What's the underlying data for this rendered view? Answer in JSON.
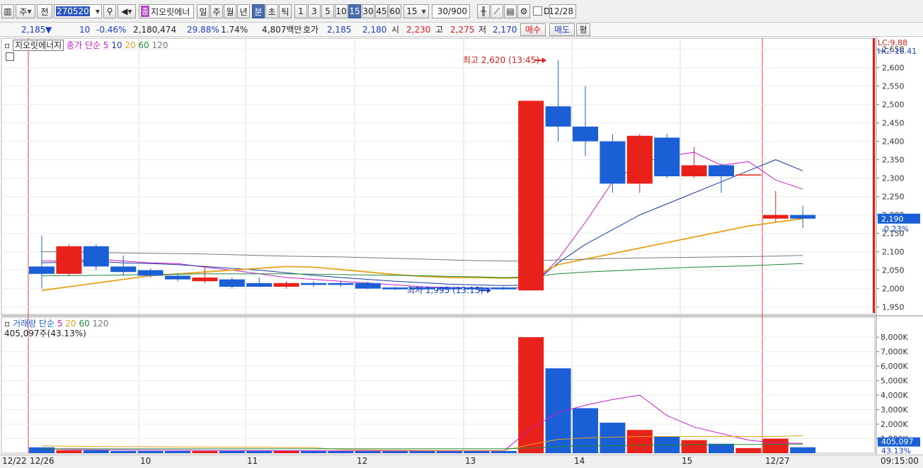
{
  "toolbar": {
    "market_buttons": [
      "주",
      "전"
    ],
    "stock_code": "270520",
    "stock_name_badge": "종",
    "stock_name": "지오릿에너",
    "period_buttons": [
      "일",
      "주",
      "월",
      "년",
      "분",
      "초",
      "틱"
    ],
    "selected_period": "분",
    "interval_buttons": [
      "1",
      "3",
      "5",
      "10",
      "15",
      "30",
      "45",
      "60"
    ],
    "selected_interval": "15",
    "interval_value": "15",
    "count_value": "30/900",
    "date_checkbox_label": "D",
    "date_value": "12/28"
  },
  "quote": {
    "price": "2,185",
    "change_arrow": "▼",
    "change": "10",
    "change_pct": "-0.46%",
    "volume": "2,180,474",
    "turnover_pct": "29.88%",
    "ratio": "1.74%",
    "amount": "4,807백만",
    "bid_label": "호가",
    "ask": "2,185",
    "bid": "2,180",
    "open_label": "시",
    "open": "2,230",
    "high_label": "고",
    "high": "2,275",
    "low_label": "저",
    "low": "2,170",
    "buy_button": "매수",
    "sell_button": "매도",
    "eval_button": "평"
  },
  "price_legend": {
    "stock_name": "지오릿에너지",
    "indicator": "종가 단순",
    "periods": [
      "5",
      "10",
      "20",
      "60",
      "120"
    ],
    "period_colors": [
      "#c81ec8",
      "#1a3a9e",
      "#e6a21a",
      "#1e8a3a",
      "#7a7a7a"
    ]
  },
  "volume_legend": {
    "indicator": "거래량 단순",
    "periods": [
      "5",
      "20",
      "60",
      "120"
    ],
    "current": "405,097주(43.13%)"
  },
  "annotations": {
    "high_label": "최고 2,620 (13:45)",
    "low_label": "최저 1,995 (13:15)",
    "lc": "LC:9.88",
    "hc": "HC:-16.41",
    "price_tag": "2,190",
    "price_tag_pct": "-0.23%",
    "volume_tag": "405,097",
    "volume_tag_pct": "43.13%"
  },
  "x_axis_labels": [
    "12/22",
    "12/26",
    "10",
    "11",
    "12",
    "13",
    "14",
    "15",
    "12/27"
  ],
  "time_label": "09:15:00",
  "colors": {
    "up": "#e8221a",
    "down": "#1a5fd6",
    "accent": "#4a6fb0"
  },
  "chart_data": [
    {
      "type": "candlestick",
      "title": "",
      "ylabel": "",
      "ylim": [
        1930,
        2680
      ],
      "y_ticks": [
        1950,
        2000,
        2050,
        2100,
        2150,
        2200,
        2250,
        2300,
        2350,
        2400,
        2450,
        2500,
        2550,
        2600,
        2650
      ],
      "candles": [
        {
          "o": 2060,
          "c": 2040,
          "h": 2145,
          "l": 2000
        },
        {
          "o": 2040,
          "c": 2115,
          "h": 2120,
          "l": 2035
        },
        {
          "o": 2115,
          "c": 2060,
          "h": 2120,
          "l": 2050
        },
        {
          "o": 2060,
          "c": 2045,
          "h": 2090,
          "l": 2035
        },
        {
          "o": 2050,
          "c": 2035,
          "h": 2055,
          "l": 2030
        },
        {
          "o": 2035,
          "c": 2025,
          "h": 2040,
          "l": 2020
        },
        {
          "o": 2020,
          "c": 2030,
          "h": 2060,
          "l": 2015
        },
        {
          "o": 2025,
          "c": 2005,
          "h": 2030,
          "l": 2000
        },
        {
          "o": 2015,
          "c": 2005,
          "h": 2030,
          "l": 2005
        },
        {
          "o": 2005,
          "c": 2015,
          "h": 2020,
          "l": 2000
        },
        {
          "o": 2015,
          "c": 2010,
          "h": 2020,
          "l": 2005
        },
        {
          "o": 2015,
          "c": 2010,
          "h": 2020,
          "l": 2005
        },
        {
          "o": 2015,
          "c": 2000,
          "h": 2020,
          "l": 1998
        },
        {
          "o": 2003,
          "c": 1998,
          "h": 2005,
          "l": 1996
        },
        {
          "o": 2003,
          "c": 1998,
          "h": 2005,
          "l": 1996
        },
        {
          "o": 2003,
          "c": 1998,
          "h": 2005,
          "l": 1996
        },
        {
          "o": 2003,
          "c": 1998,
          "h": 2005,
          "l": 1996
        },
        {
          "o": 2003,
          "c": 1998,
          "h": 2005,
          "l": 1996
        },
        {
          "o": 1995,
          "c": 2510,
          "h": 2510,
          "l": 1995
        },
        {
          "o": 2495,
          "c": 2440,
          "h": 2620,
          "l": 2400
        },
        {
          "o": 2440,
          "c": 2400,
          "h": 2550,
          "l": 2360
        },
        {
          "o": 2400,
          "c": 2285,
          "h": 2420,
          "l": 2260
        },
        {
          "o": 2285,
          "c": 2415,
          "h": 2420,
          "l": 2260
        },
        {
          "o": 2410,
          "c": 2305,
          "h": 2420,
          "l": 2300
        },
        {
          "o": 2305,
          "c": 2335,
          "h": 2385,
          "l": 2300
        },
        {
          "o": 2335,
          "c": 2305,
          "h": 2340,
          "l": 2260
        },
        {
          "o": 2310,
          "c": 2310,
          "h": 2310,
          "l": 2310
        },
        {
          "o": 2190,
          "c": 2200,
          "h": 2265,
          "l": 2180
        },
        {
          "o": 2200,
          "c": 2190,
          "h": 2225,
          "l": 2165
        }
      ],
      "ma": [
        {
          "name": "5",
          "values": [
            2075,
            2075,
            2080,
            2075,
            2070,
            2068,
            2058,
            2050,
            2040,
            2030,
            2025,
            2020,
            2015,
            2010,
            2005,
            2003,
            2002,
            2000,
            2005,
            2080,
            2180,
            2290,
            2340,
            2360,
            2370,
            2335,
            2345,
            2295,
            2270
          ]
        },
        {
          "name": "10",
          "values": [
            2070,
            2072,
            2074,
            2070,
            2068,
            2065,
            2060,
            2055,
            2050,
            2043,
            2036,
            2030,
            2025,
            2020,
            2016,
            2012,
            2010,
            2008,
            2010,
            2070,
            2120,
            2160,
            2200,
            2230,
            2260,
            2290,
            2320,
            2350,
            2320
          ]
        },
        {
          "name": "20",
          "values": [
            1995,
            2005,
            2015,
            2025,
            2035,
            2040,
            2045,
            2050,
            2055,
            2060,
            2058,
            2052,
            2045,
            2038,
            2033,
            2030,
            2030,
            2028,
            2030,
            2065,
            2080,
            2095,
            2110,
            2125,
            2140,
            2155,
            2170,
            2180,
            2190
          ]
        },
        {
          "name": "60",
          "values": [
            2035,
            2035,
            2036,
            2037,
            2038,
            2039,
            2040,
            2040,
            2040,
            2040,
            2039,
            2038,
            2037,
            2036,
            2035,
            2033,
            2032,
            2030,
            2032,
            2040,
            2045,
            2048,
            2052,
            2055,
            2058,
            2060,
            2062,
            2065,
            2068
          ]
        },
        {
          "name": "120",
          "values": [
            2100,
            2100,
            2098,
            2097,
            2096,
            2095,
            2094,
            2092,
            2090,
            2088,
            2087,
            2086,
            2084,
            2082,
            2080,
            2078,
            2076,
            2075,
            2075,
            2078,
            2080,
            2082,
            2083,
            2084,
            2085,
            2086,
            2087,
            2088,
            2090
          ]
        }
      ]
    },
    {
      "type": "bar",
      "title": "",
      "ylabel": "",
      "ylim": [
        0,
        8500
      ],
      "y_ticks": [
        1000,
        2000,
        3000,
        4000,
        5000,
        6000,
        7000,
        8000
      ],
      "y_tick_labels": [
        "1,000K",
        "2,000K",
        "3,000K",
        "4,000K",
        "5,000K",
        "6,000K",
        "7,000K",
        "8,000K"
      ],
      "values": [
        400,
        200,
        200,
        150,
        150,
        150,
        150,
        150,
        150,
        150,
        150,
        150,
        150,
        150,
        150,
        150,
        150,
        150,
        8000,
        5850,
        3100,
        2100,
        1600,
        1150,
        900,
        650,
        350,
        1000,
        405
      ],
      "ma": [
        {
          "name": "5",
          "values": [
            300,
            260,
            230,
            220,
            210,
            200,
            190,
            180,
            175,
            170,
            165,
            160,
            155,
            150,
            150,
            150,
            150,
            150,
            1700,
            2800,
            3300,
            3700,
            4000,
            2600,
            1800,
            1350,
            900,
            700,
            680
          ]
        },
        {
          "name": "20",
          "values": [
            500,
            480,
            460,
            450,
            440,
            430,
            420,
            410,
            400,
            390,
            380,
            250,
            220,
            200,
            190,
            180,
            180,
            180,
            600,
            950,
            1050,
            1100,
            1150,
            1150,
            1150,
            1150,
            1150,
            1150,
            1200
          ]
        },
        {
          "name": "60",
          "values": [
            300,
            300,
            300,
            300,
            300,
            300,
            300,
            300,
            300,
            300,
            300,
            300,
            300,
            300,
            300,
            300,
            300,
            300,
            350,
            450,
            500,
            520,
            540,
            560,
            580,
            590,
            600,
            610,
            620
          ]
        }
      ]
    }
  ]
}
